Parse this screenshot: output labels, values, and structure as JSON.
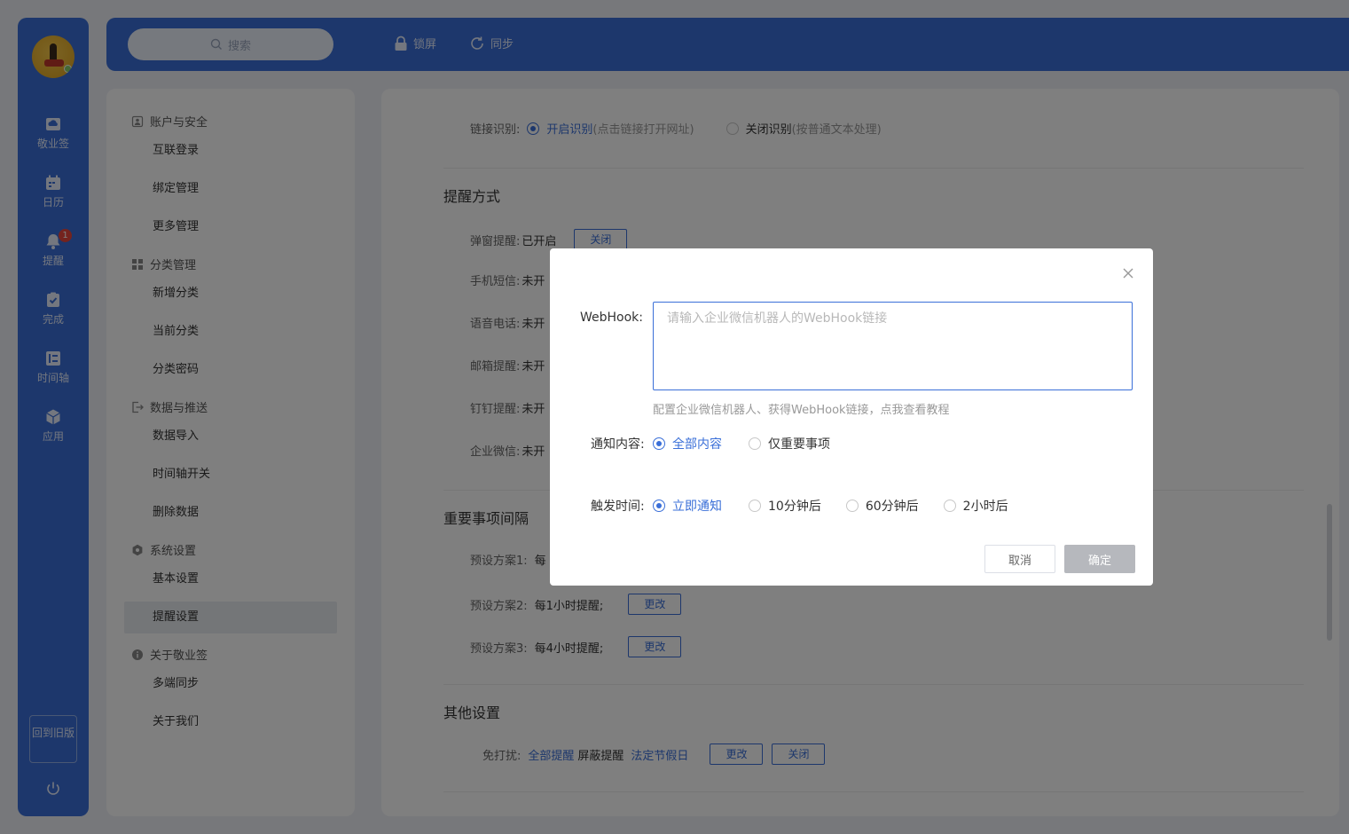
{
  "rail": {
    "items": [
      {
        "label": "敬业签",
        "icon": "cloud-icon"
      },
      {
        "label": "日历",
        "icon": "calendar-icon"
      },
      {
        "label": "提醒",
        "icon": "bell-icon",
        "badge": "1"
      },
      {
        "label": "完成",
        "icon": "check-clipboard-icon"
      },
      {
        "label": "时间轴",
        "icon": "timeline-icon"
      },
      {
        "label": "应用",
        "icon": "cube-icon"
      }
    ],
    "old_version": "回到旧版"
  },
  "topbar": {
    "search_placeholder": "搜索",
    "lock_label": "锁屏",
    "sync_label": "同步"
  },
  "settings_nav": {
    "groups": [
      {
        "title": "账户与安全",
        "items": [
          "互联登录",
          "绑定管理",
          "更多管理"
        ]
      },
      {
        "title": "分类管理",
        "items": [
          "新增分类",
          "当前分类",
          "分类密码"
        ]
      },
      {
        "title": "数据与推送",
        "items": [
          "数据导入",
          "时间轴开关",
          "删除数据"
        ]
      },
      {
        "title": "系统设置",
        "items": [
          "基本设置",
          "提醒设置"
        ]
      },
      {
        "title": "关于敬业签",
        "items": [
          "多端同步",
          "关于我们"
        ]
      }
    ],
    "active_item": "提醒设置"
  },
  "main": {
    "link_recognition": {
      "label": "链接识别:",
      "on_label": "开启识别",
      "on_note": "(点击链接打开网址)",
      "off_label": "关闭识别",
      "off_note": "(按普通文本处理)"
    },
    "remind_section_title": "提醒方式",
    "remind_rows": [
      {
        "label": "弹窗提醒:",
        "value": "已开启",
        "button": "关闭"
      },
      {
        "label": "手机短信:",
        "value": "未开"
      },
      {
        "label": "语音电话:",
        "value": "未开"
      },
      {
        "label": "邮箱提醒:",
        "value": "未开"
      },
      {
        "label": "钉钉提醒:",
        "value": "未开"
      },
      {
        "label": "企业微信:",
        "value": "未开"
      }
    ],
    "interval_section_title": "重要事项间隔",
    "interval_rows": [
      {
        "label": "预设方案1:",
        "value": "每"
      },
      {
        "label": "预设方案2:",
        "value": "每1小时提醒;",
        "button": "更改"
      },
      {
        "label": "预设方案3:",
        "value": "每4小时提醒;",
        "button": "更改"
      }
    ],
    "other_section_title": "其他设置",
    "dnd": {
      "label": "免打扰:",
      "opt1": "全部提醒",
      "opt2": "屏蔽提醒",
      "opt3": "法定节假日",
      "change_btn": "更改",
      "close_btn": "关闭"
    }
  },
  "modal": {
    "webhook_label": "WebHook:",
    "webhook_placeholder": "请输入企业微信机器人的WebHook链接",
    "hint": "配置企业微信机器人、获得WebHook链接，点我查看教程",
    "content_label": "通知内容:",
    "content_options": [
      "全部内容",
      "仅重要事项"
    ],
    "content_selected": "全部内容",
    "trigger_label": "触发时间:",
    "trigger_options": [
      "立即通知",
      "10分钟后",
      "60分钟后",
      "2小时后"
    ],
    "trigger_selected": "立即通知",
    "cancel_label": "取消",
    "ok_label": "确定"
  },
  "colors": {
    "accent": "#3a6fd8",
    "rail_bg": "#3a6fd8",
    "disabled_btn": "#b6b8bd",
    "badge": "#e8473d"
  }
}
